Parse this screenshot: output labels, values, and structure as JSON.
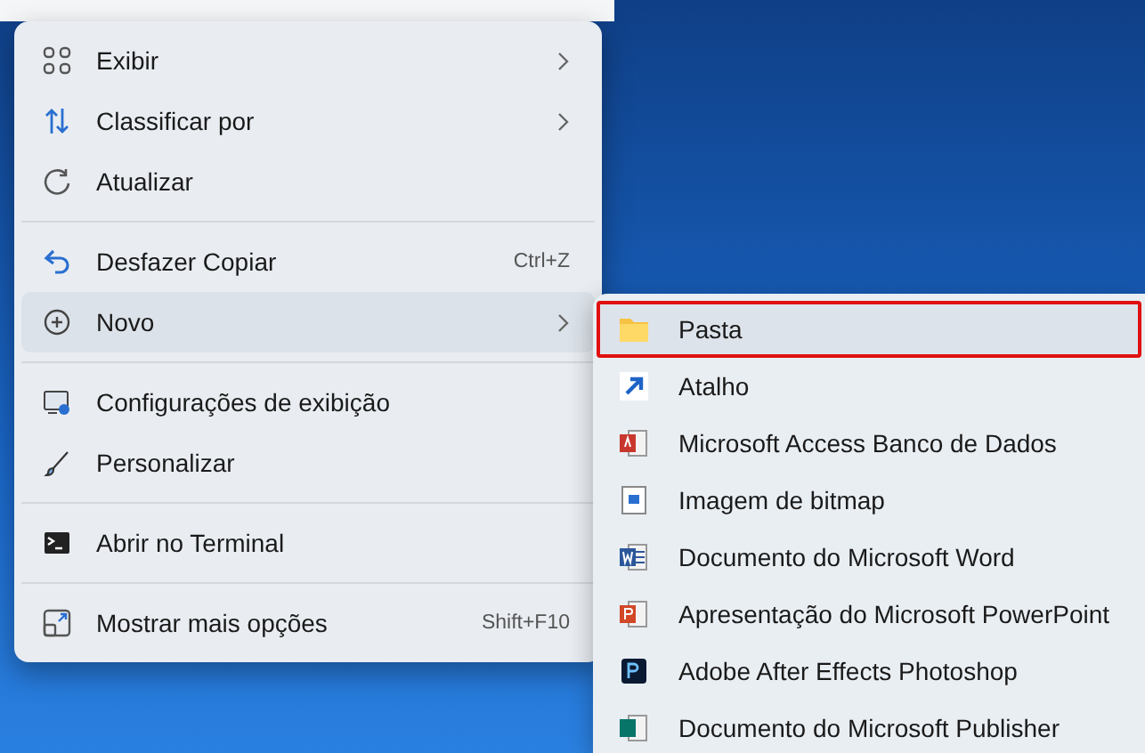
{
  "context_menu": {
    "groups": [
      {
        "items": [
          {
            "label": "Exibir",
            "submenu": true,
            "selected": false
          },
          {
            "label": "Classificar por",
            "submenu": true,
            "selected": false
          },
          {
            "label": "Atualizar",
            "submenu": false,
            "selected": false
          }
        ]
      },
      {
        "items": [
          {
            "label": "Desfazer Copiar",
            "shortcut": "Ctrl+Z",
            "submenu": false,
            "selected": false
          },
          {
            "label": "Novo",
            "submenu": true,
            "selected": true
          }
        ]
      },
      {
        "items": [
          {
            "label": "Configurações de exibição",
            "submenu": false,
            "selected": false
          },
          {
            "label": "Personalizar",
            "submenu": false,
            "selected": false
          }
        ]
      },
      {
        "items": [
          {
            "label": "Abrir no Terminal",
            "submenu": false,
            "selected": false
          }
        ]
      },
      {
        "items": [
          {
            "label": "Mostrar mais opções",
            "shortcut": "Shift+F10",
            "submenu": false,
            "selected": false
          }
        ]
      }
    ]
  },
  "new_submenu": {
    "items": [
      {
        "label": "Pasta",
        "highlighted": true
      },
      {
        "label": "Atalho",
        "highlighted": false
      },
      {
        "label": "Microsoft Access Banco de Dados",
        "highlighted": false
      },
      {
        "label": "Imagem de bitmap",
        "highlighted": false
      },
      {
        "label": "Documento do Microsoft Word",
        "highlighted": false
      },
      {
        "label": "Apresentação do Microsoft PowerPoint",
        "highlighted": false
      },
      {
        "label": "Adobe After Effects Photoshop",
        "highlighted": false
      },
      {
        "label": "Documento do Microsoft Publisher",
        "highlighted": false
      }
    ]
  }
}
